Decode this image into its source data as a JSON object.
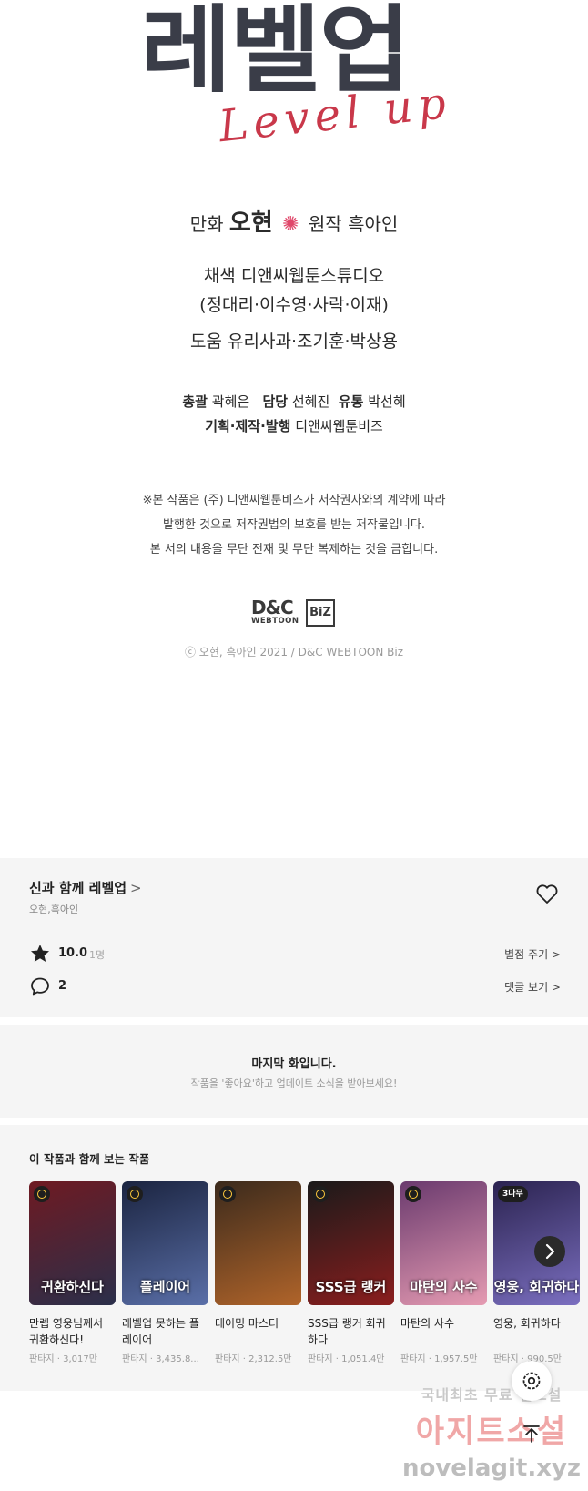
{
  "credits": {
    "logo_ko": "레벨업",
    "logo_en": "Level up",
    "manhwa_label": "만화",
    "manhwa_name": "오현",
    "flower": "✺",
    "original_label": "원작 흑아인",
    "color_line1": "채색 디앤씨웹툰스튜디오",
    "color_line2": "(정대리·이수영·사락·이재)",
    "assist_line": "도움 유리사과·조기훈·박상용",
    "general_label": "총괄",
    "general_name": "곽혜은",
    "manager_label": "담당",
    "manager_name": "선혜진",
    "distribution_label": "유통",
    "distribution_name": "박선혜",
    "production_label": "기획·제작·발행",
    "production_name": "디앤씨웹툰비즈",
    "notice_line1": "※본 작품은 (주) 디앤씨웹툰비즈가 저작권자와의 계약에 따라",
    "notice_line2": "발행한 것으로 저작권법의 보호를 받는 저작물입니다.",
    "notice_line3": "본 서의 내용을 무단 전재 및 무단 복제하는 것을 금합니다.",
    "dc_logo_main": "D&C",
    "dc_logo_sub": "WEBTOON",
    "dc_logo_biz": "BiZ",
    "copyright": "ⓒ 오현, 흑아인 2021 / D&C WEBTOON Biz"
  },
  "info": {
    "title": "신과 함께 레벨업",
    "title_chevron": ">",
    "authors": "오현,흑아인",
    "rating": "10.0",
    "rating_count": "1명",
    "rate_link": "별점 주기 >",
    "comments": "2",
    "comments_link": "댓글 보기 >"
  },
  "last": {
    "title": "마지막 화입니다.",
    "subtitle": "작품을 '좋아요'하고 업데이트 소식을 받아보세요!"
  },
  "recs": {
    "title": "이 작품과 함께 보는 작품",
    "items": [
      {
        "name": "만렙 영웅님께서 귀환하신다!",
        "meta": "판타지 · 3,017만",
        "caption": "귀환하신다",
        "badge": "",
        "colors": [
          "#6e1a22",
          "#2b2f4a"
        ]
      },
      {
        "name": "레벨업 못하는 플레이어",
        "meta": "판타지 · 3,435.8...",
        "caption": "플레이어",
        "badge": "",
        "colors": [
          "#1b2440",
          "#5a6fa8"
        ]
      },
      {
        "name": "테이밍 마스터",
        "meta": "판타지 · 2,312.5만",
        "caption": "",
        "badge": "",
        "colors": [
          "#3b2a1c",
          "#b0642a"
        ]
      },
      {
        "name": "SSS급 랭커 회귀하다",
        "meta": "판타지 · 1,051.4만",
        "caption": "SSS급 랭커",
        "badge": "",
        "colors": [
          "#1a1a1a",
          "#8b1e1e"
        ]
      },
      {
        "name": "마탄의 사수",
        "meta": "판타지 · 1,957.5만",
        "caption": "마탄의 사수",
        "badge": "",
        "colors": [
          "#6a3a6e",
          "#e59bb2"
        ]
      },
      {
        "name": "영웅, 회귀하다",
        "meta": "판타지 · 990.5만",
        "caption": "영웅, 회귀하다",
        "badge": "3다무",
        "colors": [
          "#2b2350",
          "#7b6fc0"
        ]
      }
    ]
  },
  "watermark": {
    "line1": "국내최초 무료 웹소설",
    "line2": "아지트소설",
    "line3": "novelagit.xyz"
  }
}
